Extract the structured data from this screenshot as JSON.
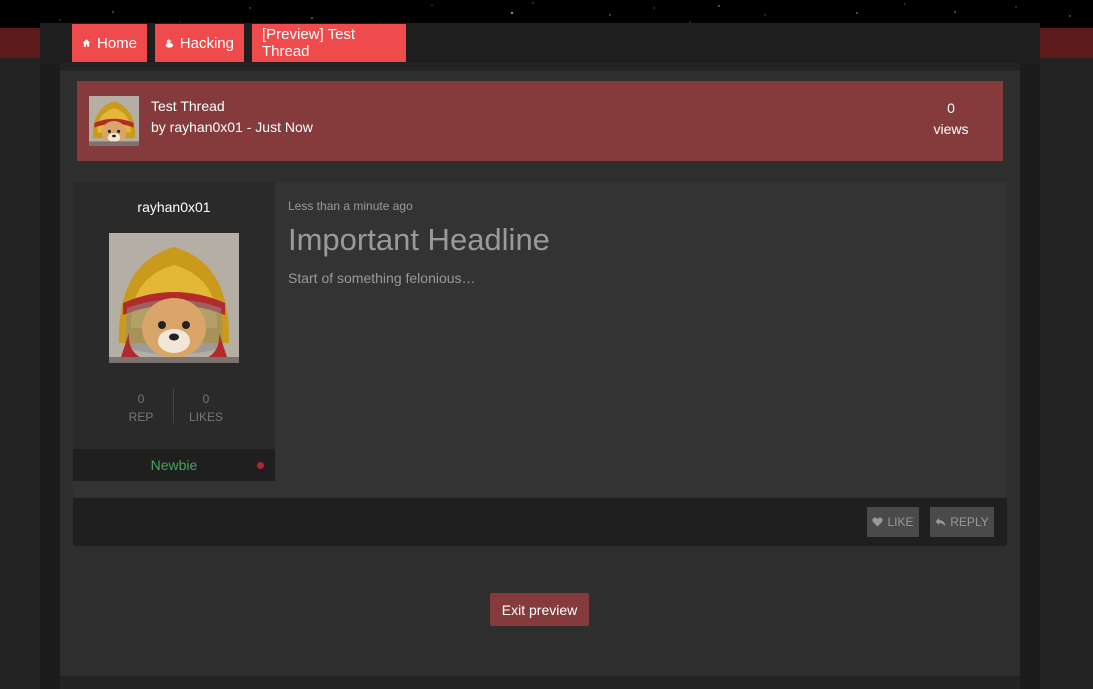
{
  "colors": {
    "nav_accent": "#ef4a4c",
    "thread_header": "#853b3c",
    "rank_green": "#4aa35a",
    "offline_dot": "#b3282c"
  },
  "nav": {
    "home": {
      "label": "Home",
      "icon": "home-icon"
    },
    "category": {
      "label": "Hacking",
      "icon": "duck-icon"
    },
    "current": {
      "label": "[Preview] Test Thread"
    }
  },
  "thread": {
    "title": "Test Thread",
    "meta": "by rayhan0x01 - Just Now",
    "views_count": "0",
    "views_label": "views"
  },
  "post": {
    "author": "rayhan0x01",
    "rep_value": "0",
    "rep_label": "REP",
    "likes_value": "0",
    "likes_label": "LIKES",
    "rank": "Newbie",
    "time": "Less than a minute ago",
    "headline": "Important Headline",
    "body": "Start of something felonious…"
  },
  "actions": {
    "like": {
      "label": "LIKE",
      "icon": "heart-icon"
    },
    "reply": {
      "label": "REPLY",
      "icon": "reply-icon"
    }
  },
  "exit_preview_label": "Exit preview"
}
